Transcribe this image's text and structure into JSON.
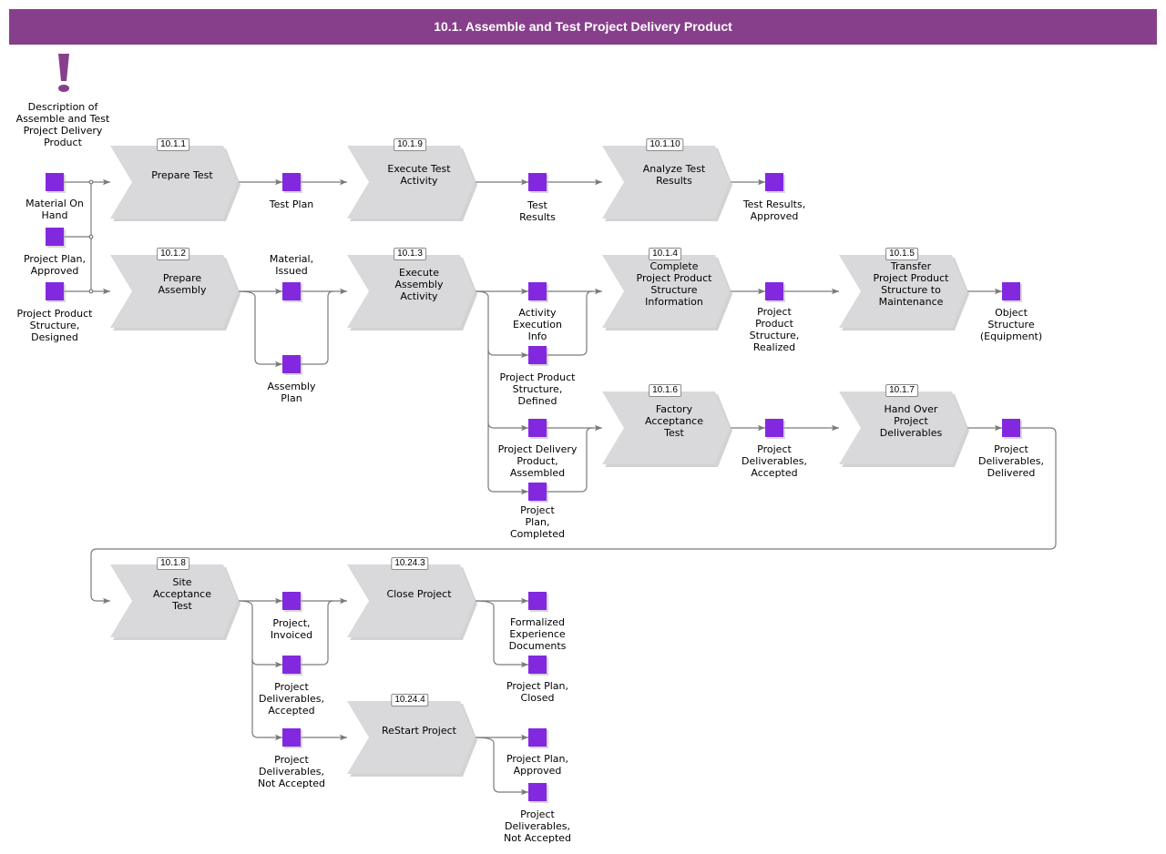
{
  "title": "10.1. Assemble and Test Project Delivery Product",
  "colors": {
    "title_bar": "#873f8b",
    "function_fill": "#d9d9db",
    "function_shadow": "#b4b4b4",
    "event_fill": "#8229e0",
    "connector": "#7a7a7a",
    "exclamation": "#873f8b"
  },
  "description": {
    "icon": "exclamation-icon",
    "label": "Description of\nAssemble and Test\nProject Delivery\nProduct"
  },
  "functions": [
    {
      "id": "10.1.1",
      "label": "Prepare Test"
    },
    {
      "id": "10.1.9",
      "label": "Execute Test\nActivity"
    },
    {
      "id": "10.1.10",
      "label": "Analyze Test\nResults"
    },
    {
      "id": "10.1.2",
      "label": "Prepare\nAssembly"
    },
    {
      "id": "10.1.3",
      "label": "Execute\nAssembly\nActivity"
    },
    {
      "id": "10.1.4",
      "label": "Complete\nProject Product\nStructure\nInformation"
    },
    {
      "id": "10.1.5",
      "label": "Transfer\nProject Product\nStructure to\nMaintenance"
    },
    {
      "id": "10.1.6",
      "label": "Factory\nAcceptance\nTest"
    },
    {
      "id": "10.1.7",
      "label": "Hand Over\nProject\nDeliverables"
    },
    {
      "id": "10.1.8",
      "label": "Site\nAcceptance\nTest"
    },
    {
      "id": "10.24.3",
      "label": "Close Project"
    },
    {
      "id": "10.24.4",
      "label": "ReStart Project"
    }
  ],
  "events": [
    {
      "label": "Material On\nHand"
    },
    {
      "label": "Project Plan,\nApproved"
    },
    {
      "label": "Project Product\nStructure,\nDesigned"
    },
    {
      "label": "Test Plan"
    },
    {
      "label": "Test\nResults"
    },
    {
      "label": "Test Results,\nApproved"
    },
    {
      "label": "Material,\nIssued"
    },
    {
      "label": "Assembly\nPlan"
    },
    {
      "label": "Activity\nExecution\nInfo"
    },
    {
      "label": "Project Product\nStructure,\nDefined"
    },
    {
      "label": "Project Delivery\nProduct,\nAssembled"
    },
    {
      "label": "Project\nPlan,\nCompleted"
    },
    {
      "label": "Project\nProduct\nStructure,\nRealized"
    },
    {
      "label": "Object\nStructure\n(Equipment)"
    },
    {
      "label": "Project\nDeliverables,\nAccepted"
    },
    {
      "label": "Project\nDeliverables,\nDelivered"
    },
    {
      "label": "Project,\nInvoiced"
    },
    {
      "label": "Project\nDeliverables,\nAccepted"
    },
    {
      "label": "Project\nDeliverables,\nNot Accepted"
    },
    {
      "label": "Formalized\nExperience\nDocuments"
    },
    {
      "label": "Project Plan,\nClosed"
    },
    {
      "label": "Project Plan,\nApproved"
    },
    {
      "label": "Project\nDeliverables,\nNot Accepted"
    }
  ]
}
